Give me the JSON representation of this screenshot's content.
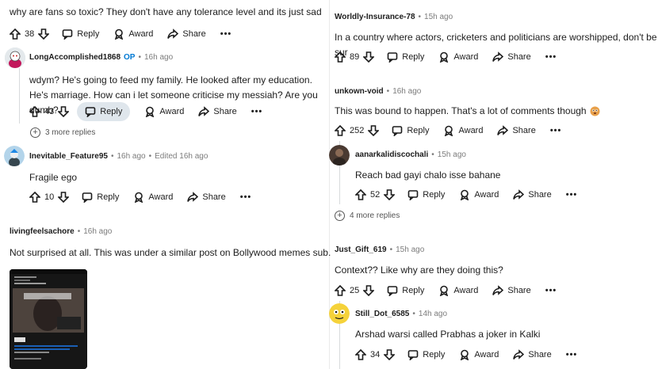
{
  "left": {
    "top_comment": {
      "text": "why are fans so toxic? They don't have any tolerance level and its just sad",
      "votes": "38"
    },
    "c1": {
      "user": "LongAccomplished1868",
      "op": "OP",
      "time": "16h ago",
      "text": "wdym? He's going to feed my family. He looked after my education. He's marriage. How can i let someone criticise my messiah? Are you dumb?",
      "votes": "43",
      "more_replies": "3 more replies"
    },
    "c2": {
      "user": "Inevitable_Feature95",
      "time": "16h ago",
      "edited": "Edited 16h ago",
      "text": "Fragile ego",
      "votes": "10"
    },
    "c3": {
      "user": "livingfeelsachore",
      "time": "16h ago",
      "text": "Not surprised at all. This was under a similar post on Bollywood memes sub."
    }
  },
  "right": {
    "c4": {
      "user": "Worldly-Insurance-78",
      "time": "15h ago",
      "text": "In a country where actors, cricketers and politicians are worshipped, don't be sur",
      "votes": "89"
    },
    "c5": {
      "user": "unkown-void",
      "time": "16h ago",
      "text": "This was bound to happen. That's a lot of comments though",
      "votes": "252"
    },
    "c6": {
      "user": "aanarkalidiscochali",
      "time": "15h ago",
      "text": "Reach bad gayi chalo isse bahane",
      "votes": "52",
      "more_replies": "4 more replies"
    },
    "c7": {
      "user": "Just_Gift_619",
      "time": "15h ago",
      "text": "Context?? Like why are they doing this?",
      "votes": "25"
    },
    "c8": {
      "user": "Still_Dot_6585",
      "time": "14h ago",
      "text": "Arshad warsi called Prabhas a joker in Kalki",
      "votes": "34"
    }
  },
  "labels": {
    "reply": "Reply",
    "award": "Award",
    "share": "Share",
    "more": "•••",
    "dot": "•",
    "plus": "+"
  },
  "colors": {
    "op_blue": "#0079d3",
    "reply_active_bg": "#dfe6ec",
    "thread_line": "#d7dadc"
  }
}
